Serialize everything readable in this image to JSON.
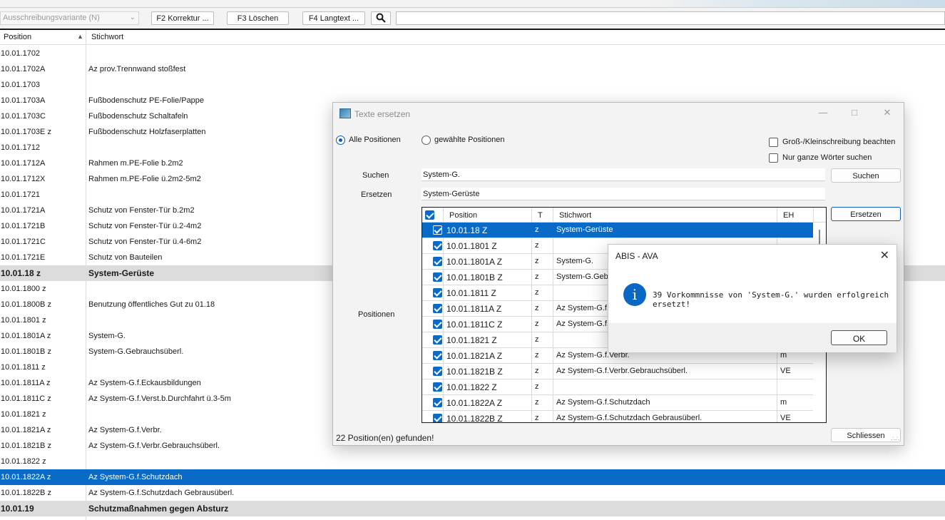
{
  "toolbar": {
    "variant_select": "Ausschreibungsvariante (N)",
    "btn_f2": "F2 Korrektur ...",
    "btn_f3": "F3 Löschen",
    "btn_f4": "F4 Langtext ..."
  },
  "list": {
    "col_position": "Position",
    "col_stichwort": "Stichwort",
    "rows": [
      {
        "pos": "10.01.1702",
        "kw": ""
      },
      {
        "pos": "10.01.1702A",
        "kw": "Az prov.Trennwand stoßfest"
      },
      {
        "pos": "10.01.1703",
        "kw": ""
      },
      {
        "pos": "10.01.1703A",
        "kw": "Fußbodenschutz PE-Folie/Pappe"
      },
      {
        "pos": "10.01.1703C",
        "kw": "Fußbodenschutz Schaltafeln"
      },
      {
        "pos": "10.01.1703E  z",
        "kw": "Fußbodenschutz Holzfaserplatten"
      },
      {
        "pos": "10.01.1712",
        "kw": ""
      },
      {
        "pos": "10.01.1712A",
        "kw": "Rahmen m.PE-Folie b.2m2"
      },
      {
        "pos": "10.01.1712X",
        "kw": "Rahmen m.PE-Folie ü.2m2-5m2"
      },
      {
        "pos": "10.01.1721",
        "kw": ""
      },
      {
        "pos": "10.01.1721A",
        "kw": "Schutz von Fenster-Tür b.2m2"
      },
      {
        "pos": "10.01.1721B",
        "kw": "Schutz von Fenster-Tür ü.2-4m2"
      },
      {
        "pos": "10.01.1721C",
        "kw": "Schutz von Fenster-Tür ü.4-6m2"
      },
      {
        "pos": "10.01.1721E",
        "kw": "Schutz von Bauteilen"
      },
      {
        "pos": "10.01.18  z",
        "kw": "System-Gerüste",
        "group": true
      },
      {
        "pos": "10.01.1800  z",
        "kw": ""
      },
      {
        "pos": "10.01.1800B  z",
        "kw": "Benutzung öffentliches Gut zu 01.18"
      },
      {
        "pos": "10.01.1801  z",
        "kw": ""
      },
      {
        "pos": "10.01.1801A  z",
        "kw": "System-G."
      },
      {
        "pos": "10.01.1801B  z",
        "kw": "System-G.Gebrauchsüberl."
      },
      {
        "pos": "10.01.1811  z",
        "kw": ""
      },
      {
        "pos": "10.01.1811A  z",
        "kw": "Az System-G.f.Eckausbildungen"
      },
      {
        "pos": "10.01.1811C  z",
        "kw": "Az System-G.f.Verst.b.Durchfahrt ü.3-5m"
      },
      {
        "pos": "10.01.1821  z",
        "kw": ""
      },
      {
        "pos": "10.01.1821A  z",
        "kw": "Az System-G.f.Verbr."
      },
      {
        "pos": "10.01.1821B  z",
        "kw": "Az System-G.f.Verbr.Gebrauchsüberl."
      },
      {
        "pos": "10.01.1822  z",
        "kw": ""
      },
      {
        "pos": "10.01.1822A  z",
        "kw": "Az System-G.f.Schutzdach",
        "selected": true
      },
      {
        "pos": "10.01.1822B  z",
        "kw": "Az System-G.f.Schutzdach Gebrausüberl."
      },
      {
        "pos": "10.01.19",
        "kw": "Schutzmaßnahmen gegen Absturz",
        "group": true
      }
    ]
  },
  "dialog": {
    "title": "Texte ersetzen",
    "radio_all": "Alle Positionen",
    "radio_selected": "gewählte Positionen",
    "chk_case": "Groß-/Kleinschreibung beachten",
    "chk_whole": "Nur ganze Wörter suchen",
    "label_search": "Suchen",
    "search_value": "System-G.",
    "label_replace": "Ersetzen",
    "replace_value": "System-Gerüste",
    "label_positions": "Positionen",
    "btn_search": "Suchen",
    "btn_replace": "Ersetzen",
    "btn_close": "Schliessen",
    "status": "22 Position(en) gefunden!",
    "grid_head": {
      "pos": "Position",
      "t": "T",
      "s": "Stichwort",
      "eh": "EH"
    },
    "grid_rows": [
      {
        "pos": "10.01.18  Z",
        "t": "z",
        "s": "System-Gerüste",
        "eh": "",
        "sel": true
      },
      {
        "pos": "10.01.1801  Z",
        "t": "z",
        "s": "",
        "eh": ""
      },
      {
        "pos": "10.01.1801A  Z",
        "t": "z",
        "s": "System-G.",
        "eh": ""
      },
      {
        "pos": "10.01.1801B  Z",
        "t": "z",
        "s": "System-G.Gebra",
        "eh": ""
      },
      {
        "pos": "10.01.1811  Z",
        "t": "z",
        "s": "",
        "eh": ""
      },
      {
        "pos": "10.01.1811A  Z",
        "t": "z",
        "s": "Az System-G.f.E",
        "eh": ""
      },
      {
        "pos": "10.01.1811C  Z",
        "t": "z",
        "s": "Az System-G.f.V",
        "eh": ""
      },
      {
        "pos": "10.01.1821  Z",
        "t": "z",
        "s": "",
        "eh": ""
      },
      {
        "pos": "10.01.1821A  Z",
        "t": "z",
        "s": "Az System-G.f.Verbr.",
        "eh": "m"
      },
      {
        "pos": "10.01.1821B  Z",
        "t": "z",
        "s": "Az System-G.f.Verbr.Gebrauchsüberl.",
        "eh": "VE"
      },
      {
        "pos": "10.01.1822  Z",
        "t": "z",
        "s": "",
        "eh": ""
      },
      {
        "pos": "10.01.1822A  Z",
        "t": "z",
        "s": "Az System-G.f.Schutzdach",
        "eh": "m"
      },
      {
        "pos": "10.01.1822B  Z",
        "t": "z",
        "s": "Az System-G.f.Schutzdach Gebrausüberl.",
        "eh": "VE"
      }
    ]
  },
  "msgbox": {
    "title": "ABIS - AVA",
    "text": "39 Vorkommnisse von 'System-G.' wurden erfolgreich ersetzt!",
    "ok": "OK",
    "icon": "info-icon"
  },
  "colors": {
    "accent": "#0a6ac8",
    "group_row": "#dcdcdc"
  }
}
